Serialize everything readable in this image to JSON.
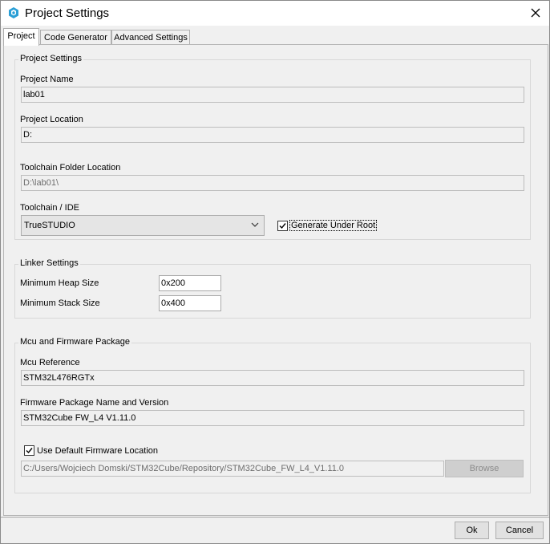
{
  "window": {
    "title": "Project Settings"
  },
  "tabs": [
    {
      "label": "Project",
      "active": true
    },
    {
      "label": "Code Generator",
      "active": false
    },
    {
      "label": "Advanced Settings",
      "active": false
    }
  ],
  "project_settings": {
    "group_title": "Project Settings",
    "name_label": "Project Name",
    "name_value": "lab01",
    "location_label": "Project Location",
    "location_value": "D:",
    "toolchain_folder_label": "Toolchain Folder Location",
    "toolchain_folder_value": "D:\\lab01\\",
    "toolchain_label": "Toolchain / IDE",
    "toolchain_value": "TrueSTUDIO",
    "generate_under_root_label": "Generate Under Root",
    "generate_under_root_checked": true
  },
  "linker_settings": {
    "group_title": "Linker Settings",
    "heap_label": "Minimum Heap Size",
    "heap_value": "0x200",
    "stack_label": "Minimum Stack Size",
    "stack_value": "0x400"
  },
  "mcu_firmware": {
    "group_title": "Mcu and Firmware Package",
    "mcu_ref_label": "Mcu Reference",
    "mcu_ref_value": "STM32L476RGTx",
    "fw_package_label": "Firmware Package Name and Version",
    "fw_package_value": "STM32Cube FW_L4 V1.11.0",
    "use_default_label": "Use Default Firmware Location",
    "use_default_checked": true,
    "fw_location_value": "C:/Users/Wojciech Domski/STM32Cube/Repository/STM32Cube_FW_L4_V1.11.0",
    "browse_label": "Browse"
  },
  "footer": {
    "ok_label": "Ok",
    "cancel_label": "Cancel"
  },
  "colors": {
    "accent": "#1e90c8"
  }
}
